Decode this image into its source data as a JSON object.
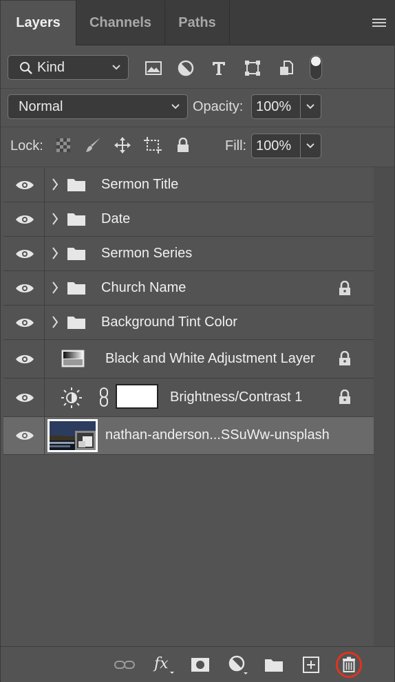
{
  "tabs": [
    {
      "label": "Layers",
      "active": true
    },
    {
      "label": "Channels",
      "active": false
    },
    {
      "label": "Paths",
      "active": false
    }
  ],
  "filter": {
    "kind_label": "Kind"
  },
  "blend": {
    "mode": "Normal",
    "opacity_label": "Opacity:",
    "opacity_value": "100%"
  },
  "lock": {
    "label": "Lock:",
    "fill_label": "Fill:",
    "fill_value": "100%"
  },
  "layers": [
    {
      "name": "Sermon Title",
      "type": "group",
      "locked": false
    },
    {
      "name": "Date",
      "type": "group",
      "locked": false
    },
    {
      "name": "Sermon Series",
      "type": "group",
      "locked": false
    },
    {
      "name": "Church Name",
      "type": "group",
      "locked": true
    },
    {
      "name": "Background Tint Color",
      "type": "group",
      "locked": false
    },
    {
      "name": "Black and White Adjustment Layer",
      "type": "adjustment",
      "locked": true
    },
    {
      "name": "Brightness/Contrast 1",
      "type": "brightness-contrast",
      "locked": true
    },
    {
      "name": "nathan-anderson...SSuWw-unsplash",
      "type": "image",
      "locked": false,
      "selected": true
    }
  ],
  "colors": {
    "panel": "#535353",
    "highlight": "#6a6a6a",
    "delete_circle": "#e2331f"
  }
}
